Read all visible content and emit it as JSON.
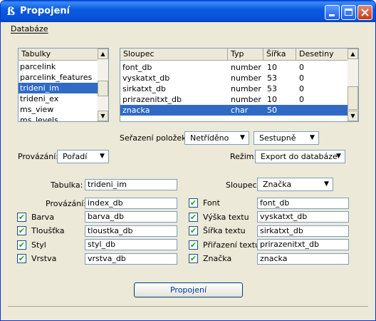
{
  "window": {
    "title": "Propojení",
    "icon": "microstation-icon"
  },
  "menu": {
    "items": [
      {
        "label": "Databáze"
      }
    ]
  },
  "tables_list": {
    "header": "Tabulky",
    "items": [
      "parcelink",
      "parcelink_features",
      "trideni_im",
      "trideni_ex",
      "ms_view",
      "ms_levels"
    ],
    "selected": "trideni_im"
  },
  "columns_list": {
    "headers": {
      "col": "Sloupec",
      "type": "Typ",
      "width": "Šířka",
      "dec": "Desetiny"
    },
    "rows": [
      {
        "col": "font_db",
        "type": "number",
        "width": "10",
        "dec": "0"
      },
      {
        "col": "vyskatxt_db",
        "type": "number",
        "width": "53",
        "dec": "0"
      },
      {
        "col": "sirkatxt_db",
        "type": "number",
        "width": "53",
        "dec": "0"
      },
      {
        "col": "prirazenitxt_db",
        "type": "number",
        "width": "10",
        "dec": "0"
      },
      {
        "col": "znacka",
        "type": "char",
        "width": "50",
        "dec": ""
      }
    ],
    "selected_index": 4
  },
  "sort": {
    "label": "Seřazení položek:",
    "order": "Netříděno",
    "direction": "Sestupně"
  },
  "linking": {
    "label": "Provázání:",
    "value": "Pořadí"
  },
  "mode": {
    "label": "Režim:",
    "value": "Export do databáze"
  },
  "table_field": {
    "label": "Tabulka:",
    "value": "trideni_im"
  },
  "column_field": {
    "label": "Sloupec:",
    "value": "Značka"
  },
  "left_fields": [
    {
      "label": "Provázání:",
      "value": "index_db",
      "checkbox": false
    },
    {
      "label": "Barva",
      "value": "barva_db",
      "checkbox": true,
      "checked": true
    },
    {
      "label": "Tloušťka",
      "value": "tloustka_db",
      "checkbox": true,
      "checked": true
    },
    {
      "label": "Styl",
      "value": "styl_db",
      "checkbox": true,
      "checked": true
    },
    {
      "label": "Vrstva",
      "value": "vrstva_db",
      "checkbox": true,
      "checked": true
    }
  ],
  "right_fields": [
    {
      "label": "Font",
      "value": "font_db",
      "checked": true
    },
    {
      "label": "Výška textu",
      "value": "vyskatxt_db",
      "checked": true
    },
    {
      "label": "Šířka textu",
      "value": "sirkatxt_db",
      "checked": true
    },
    {
      "label": "Přiřazení textu",
      "value": "prirazenitxt_db",
      "checked": true
    },
    {
      "label": "Značka",
      "value": "znacka",
      "checked": true
    }
  ],
  "check_mark": "✔",
  "link_button": {
    "label": "Propojení"
  }
}
